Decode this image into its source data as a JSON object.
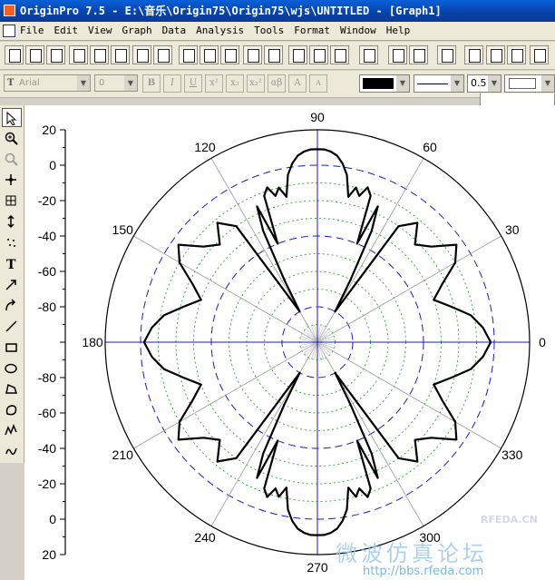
{
  "window": {
    "title": "OriginPro 7.5 - E:\\音乐\\Origin75\\Origin75\\wjs\\UNTITLED - [Graph1]"
  },
  "menu": [
    "File",
    "Edit",
    "View",
    "Graph",
    "Data",
    "Analysis",
    "Tools",
    "Format",
    "Window",
    "Help"
  ],
  "format_toolbar": {
    "font": "Arial",
    "font_icon": "T",
    "size": "0",
    "bold": "B",
    "italic": "I",
    "underline": "U",
    "superscript": "x²",
    "subscript": "x₂",
    "supsub": "x₂²",
    "greek": "αβ",
    "increase_font": "A",
    "decrease_font": "A",
    "line_width": "0.5",
    "color": "#000000"
  },
  "tools": [
    "pointer",
    "zoom-in",
    "zoom-out",
    "screen-reader",
    "data-selector",
    "data-reader",
    "region",
    "text",
    "arrow",
    "curved-arrow",
    "line",
    "rectangle",
    "circle",
    "polygon",
    "region-shape",
    "polyline",
    "freehand"
  ],
  "chart_data": {
    "type": "polar",
    "angle_labels": [
      "0",
      "30",
      "60",
      "90",
      "120",
      "150",
      "180",
      "210",
      "240",
      "270",
      "300",
      "330"
    ],
    "radial_tick_labels_upper": [
      "20",
      "0",
      "-20",
      "-40",
      "-60",
      "-80"
    ],
    "radial_tick_labels_lower": [
      "-80",
      "-60",
      "-40",
      "-20",
      "0",
      "20"
    ],
    "radial_range": [
      -100,
      20
    ],
    "dash_circle_levels": [
      -80,
      -40,
      0
    ],
    "dot_circle_levels": [
      -90,
      -70,
      -60,
      -50,
      -30,
      -20,
      -10
    ],
    "series": [
      {
        "style": "solid-black",
        "theta_deg": [
          0,
          5,
          10,
          15,
          20,
          25,
          30,
          35,
          40,
          45,
          50,
          55,
          60,
          62,
          64,
          66,
          68,
          70,
          72,
          74,
          76,
          78,
          80,
          82,
          84,
          86,
          88,
          90,
          92,
          94,
          96,
          98,
          100,
          102,
          104,
          106,
          108,
          110,
          112,
          114,
          116,
          118,
          120,
          125,
          130,
          135,
          140,
          145,
          150,
          155,
          160,
          165,
          170,
          175,
          180
        ],
        "r": [
          -2,
          -6,
          -12,
          -22,
          -30,
          -22,
          -10,
          -4,
          -16,
          -22,
          -12,
          -20,
          -80,
          -60,
          -30,
          -16,
          -40,
          -12,
          -8,
          -14,
          -10,
          -16,
          -4,
          2,
          6,
          8,
          9,
          9,
          9,
          8,
          6,
          2,
          -4,
          -16,
          -10,
          -14,
          -8,
          -12,
          -40,
          -16,
          -30,
          -60,
          -80,
          -20,
          -12,
          -22,
          -16,
          -4,
          -10,
          -22,
          -30,
          -22,
          -12,
          -6,
          -2
        ]
      }
    ]
  },
  "watermarks": {
    "logo": "RFEDA.CN",
    "site": "http://bbs.rfeda.com",
    "forum": "微波仿真论坛"
  }
}
